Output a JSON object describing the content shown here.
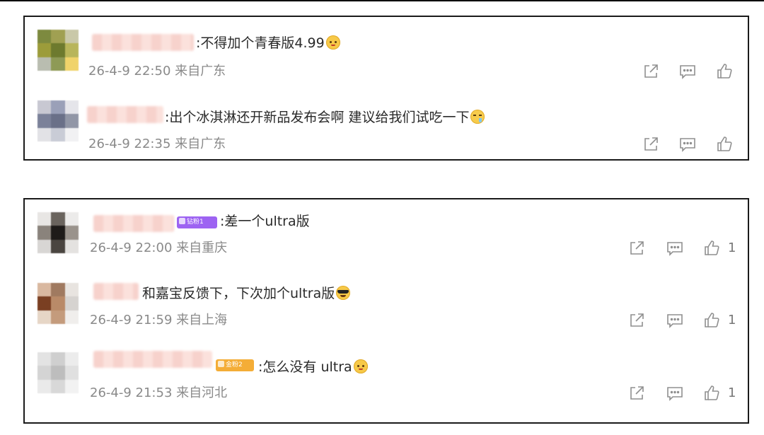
{
  "colors": {
    "meta_text": "#8a8a8a",
    "icon": "#8f8f8f",
    "badge_purple": "#9d63f2",
    "badge_orange": "#f4ad37",
    "name_blur": "#f7d2cc"
  },
  "panels": [
    {
      "comments": [
        {
          "text": ":不得加个青春版4.99",
          "emoji": "cat-smile-emoji",
          "time": "26-4-9 22:50",
          "location": "来自广东",
          "likes": ""
        },
        {
          "text": ":出个冰淇淋还开新品发布会啊  建议给我们试吃一下",
          "emoji": "drool-emoji",
          "time": "26-4-9 22:35",
          "location": "来自广东",
          "likes": ""
        }
      ]
    },
    {
      "comments": [
        {
          "badge": "钻粉1",
          "text": ":差一个ultra版",
          "emoji": "",
          "time": "26-4-9 22:00",
          "location": "来自重庆",
          "likes": "1"
        },
        {
          "text": "和嘉宝反馈下，下次加个ultra版",
          "emoji": "cool-sunglasses-emoji",
          "time": "26-4-9 21:59",
          "location": "来自上海",
          "likes": "1"
        },
        {
          "badge": "金粉2",
          "text": ":怎么没有 ultra",
          "emoji": "cat-smile-emoji",
          "time": "26-4-9 21:53",
          "location": "来自河北",
          "likes": "1"
        }
      ]
    }
  ],
  "icons": {
    "share": "share-icon",
    "reply": "comment-icon",
    "like": "thumbs-up-icon"
  }
}
